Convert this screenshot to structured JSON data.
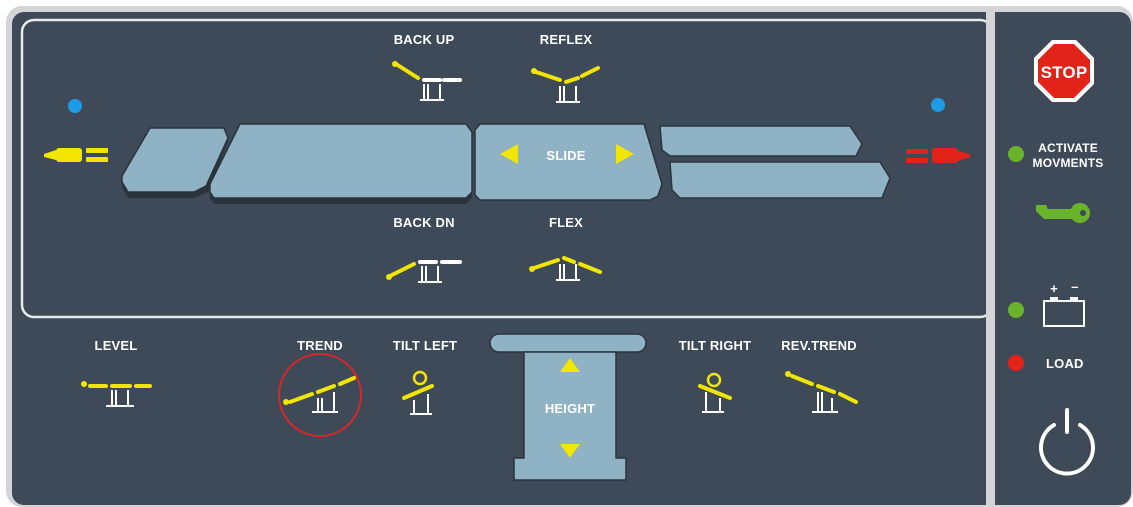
{
  "table_top": {
    "back_up_label": "BACK UP",
    "reflex_label": "REFLEX",
    "back_dn_label": "BACK DN",
    "flex_label": "FLEX",
    "slide_label": "SLIDE"
  },
  "bottom_row": {
    "level_label": "LEVEL",
    "trend_label": "TREND",
    "tilt_left_label": "TILT LEFT",
    "height_label": "HEIGHT",
    "tilt_right_label": "TILT RIGHT",
    "rev_trend_label": "REV.TREND"
  },
  "side_panel": {
    "stop_label": "STOP",
    "activate_label_line1": "ACTIVATE",
    "activate_label_line2": "MOVMENTS",
    "battery_plus": "+",
    "battery_minus": "–",
    "load_label": "LOAD"
  },
  "colors": {
    "panel_bg": "#3e4a57",
    "frame": "#d3d4d6",
    "segment": "#8fb2c4",
    "icon_yellow": "#f2e600",
    "stop_red": "#e2231a",
    "indicator_blue": "#1e9be6",
    "indicator_green": "#6ab42d",
    "indicator_red": "#e2231a",
    "highlight_circle": "#d7272a"
  },
  "icons": {
    "head_end": "head-end-plug-icon",
    "foot_end": "foot-end-plug-icon",
    "key": "key-icon",
    "battery": "battery-icon",
    "power": "power-icon"
  }
}
